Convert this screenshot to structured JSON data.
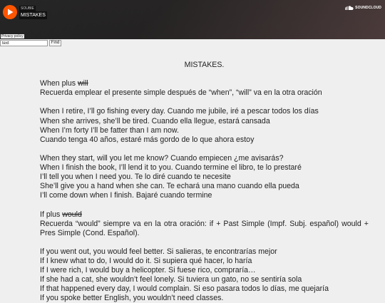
{
  "player": {
    "user": "SOUBIE",
    "track": "MISTAKES",
    "brand": "SOUNDCLOUD",
    "accent": "#ff5500"
  },
  "privacy": {
    "label": "Privacy policy"
  },
  "search": {
    "value": "text",
    "button": "Find"
  },
  "article": {
    "title": "MISTAKES.",
    "s1": {
      "heading_plain": "When plus ",
      "heading_strike": "will",
      "rule": "Recuerda emplear el presente simple después de “when”, “will” va en la otra oración"
    },
    "s2": [
      "When I retire, I’ll go fishing every day. Cuando me jubile, iré a pescar todos los días",
      "When she arrives, she’ll be tired. Cuando ella llegue, estará cansada",
      "When I’m forty I’ll be fatter than I am now.",
      "Cuando tenga 40 años, estaré más gordo de lo que ahora estoy"
    ],
    "s3": [
      "When they start, will you let me know? Cuando empiecen ¿me avisarás?",
      "When I finish the book, I’ll lend it to you. Cuando termine el libro, te lo prestaré",
      "I’ll tell you when I need you. Te lo diré cuando te necesite",
      "She’ll give you a hand when she can. Te echará una mano cuando ella pueda",
      "I’ll come down when I finish. Bajaré cuando termine"
    ],
    "s4": {
      "heading_plain": "If plus ",
      "heading_strike": "would",
      "rule": "Recuerda “would” siempre va en la otra oración: if + Past Simple (Impf. Subj. español) would + Pres Simple (Cond. Español)."
    },
    "s5": [
      "If you went out, you would feel better. Si salieras, te encontrarías mejor",
      "If I knew what to do, I would do it. Si supiera qué hacer, lo haría",
      "If I were rich, I would buy a helicopter. Si fuese rico, compraría…",
      "If she had a cat, she wouldn’t feel lonely. Si tuviera un gato, no se sentiría sola",
      "If that happened every day, I would complain. Si eso pasara todos lo días, me quejaría",
      "If you spoke better English, you wouldn’t need classes."
    ]
  }
}
